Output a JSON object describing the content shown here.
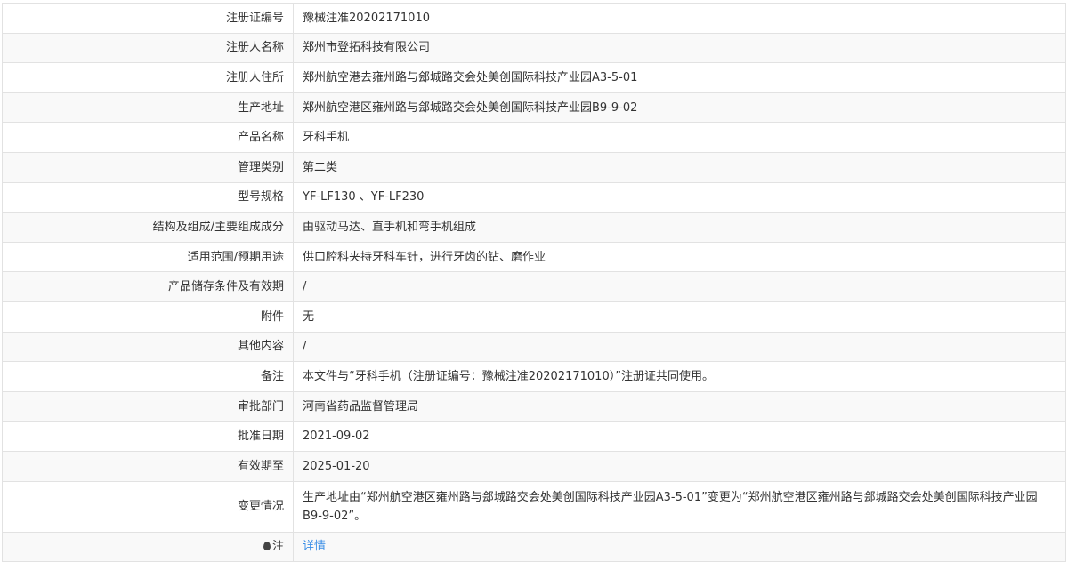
{
  "rows": [
    {
      "label": "注册证编号",
      "value": "豫械注准20202171010"
    },
    {
      "label": "注册人名称",
      "value": "郑州市登拓科技有限公司"
    },
    {
      "label": "注册人住所",
      "value": "郑州航空港去雍州路与郐城路交会处美创国际科技产业园A3-5-01"
    },
    {
      "label": "生产地址",
      "value": "郑州航空港区雍州路与郐城路交会处美创国际科技产业园B9-9-02"
    },
    {
      "label": "产品名称",
      "value": "牙科手机"
    },
    {
      "label": "管理类别",
      "value": "第二类"
    },
    {
      "label": "型号规格",
      "value": "YF-LF130 、YF-LF230"
    },
    {
      "label": "结构及组成/主要组成成分",
      "value": "由驱动马达、直手机和弯手机组成"
    },
    {
      "label": "适用范围/预期用途",
      "value": "供口腔科夹持牙科车针，进行牙齿的钻、磨作业"
    },
    {
      "label": "产品储存条件及有效期",
      "value": "/"
    },
    {
      "label": "附件",
      "value": "无"
    },
    {
      "label": "其他内容",
      "value": "/"
    },
    {
      "label": "备注",
      "value": "本文件与“牙科手机（注册证编号：豫械注准20202171010）”注册证共同使用。"
    },
    {
      "label": "审批部门",
      "value": "河南省药品监督管理局"
    },
    {
      "label": "批准日期",
      "value": "2021-09-02"
    },
    {
      "label": "有效期至",
      "value": "2025-01-20"
    },
    {
      "label": "变更情况",
      "value": "生产地址由“郑州航空港区雍州路与郐城路交会处美创国际科技产业园A3-5-01”变更为“郑州航空港区雍州路与郐城路交会处美创国际科技产业园B9-9-02”。"
    }
  ],
  "note": {
    "label": "注",
    "link": "详情",
    "icon": "map-pin-icon"
  }
}
